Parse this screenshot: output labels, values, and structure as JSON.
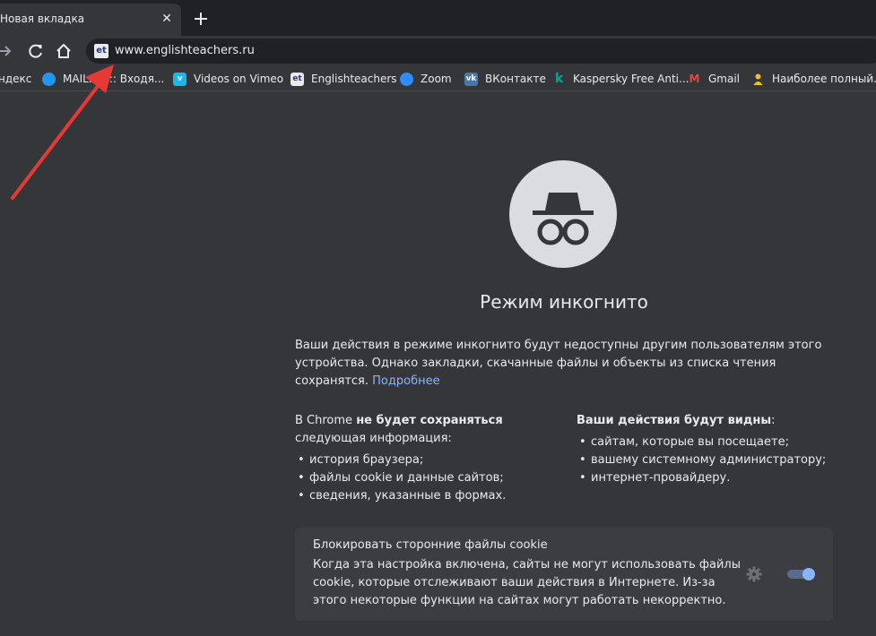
{
  "tab": {
    "title": "Новая вкладка",
    "close_glyph": "✕"
  },
  "toolbar": {
    "url": "www.englishteachers.ru",
    "favicon_text": "et"
  },
  "bookmarks": [
    {
      "label": "ндекс",
      "icon": "yandex-icon",
      "color": "#fc3f1d"
    },
    {
      "label": "MAIL.Ru :: Входя...",
      "icon": "mail-ru-icon",
      "color": "#2196f3"
    },
    {
      "label": "Videos on Vimeo",
      "icon": "vimeo-icon",
      "color": "#1ab7ea"
    },
    {
      "label": "Englishteachers",
      "icon": "englishteachers-icon",
      "color": "#e8eaed"
    },
    {
      "label": "Zoom",
      "icon": "zoom-icon",
      "color": "#2d8cff"
    },
    {
      "label": "ВКонтакте",
      "icon": "vk-icon",
      "color": "#4a76a8"
    },
    {
      "label": "Kaspersky Free Anti...",
      "icon": "kaspersky-icon",
      "color": "#00a88e"
    },
    {
      "label": "Gmail",
      "icon": "gmail-icon",
      "color": "#ea4335"
    },
    {
      "label": "Наиболее полный...",
      "icon": "person-icon",
      "color": "#f4c20d"
    }
  ],
  "incognito": {
    "heading": "Режим инкогнито",
    "intro_text": "Ваши действия в режиме инкогнито будут недоступны другим пользователям этого устройства. Однако закладки, скачанные файлы и объекты из списка чтения сохранятся.",
    "learn_more": "Подробнее",
    "not_saved_title_part1": "В Chrome ",
    "not_saved_title_bold": "не будет сохраняться",
    "not_saved_title_part2": "следующая информация:",
    "not_saved_items": [
      "история браузера;",
      "файлы cookie и данные сайтов;",
      "сведения, указанные в формах."
    ],
    "visible_title_bold": "Ваши действия будут видны",
    "visible_title_colon": ":",
    "visible_items": [
      "сайтам, которые вы посещаете;",
      "вашему системному администратору;",
      "интернет-провайдеру."
    ],
    "cookie_title": "Блокировать сторонние файлы cookie",
    "cookie_desc": "Когда эта настройка включена, сайты не могут использовать файлы cookie, которые отслеживают ваши действия в Интернете. Из-за этого некоторые функции на сайтах могут работать некорректно.",
    "cookie_toggle_on": true
  },
  "colors": {
    "page_bg": "#35363a",
    "tabstrip_bg": "#202124",
    "link": "#8ab4f8",
    "arrow": "#e53935",
    "toggle_knob": "#8ab4f8",
    "toggle_track": "#5b6b8e"
  }
}
